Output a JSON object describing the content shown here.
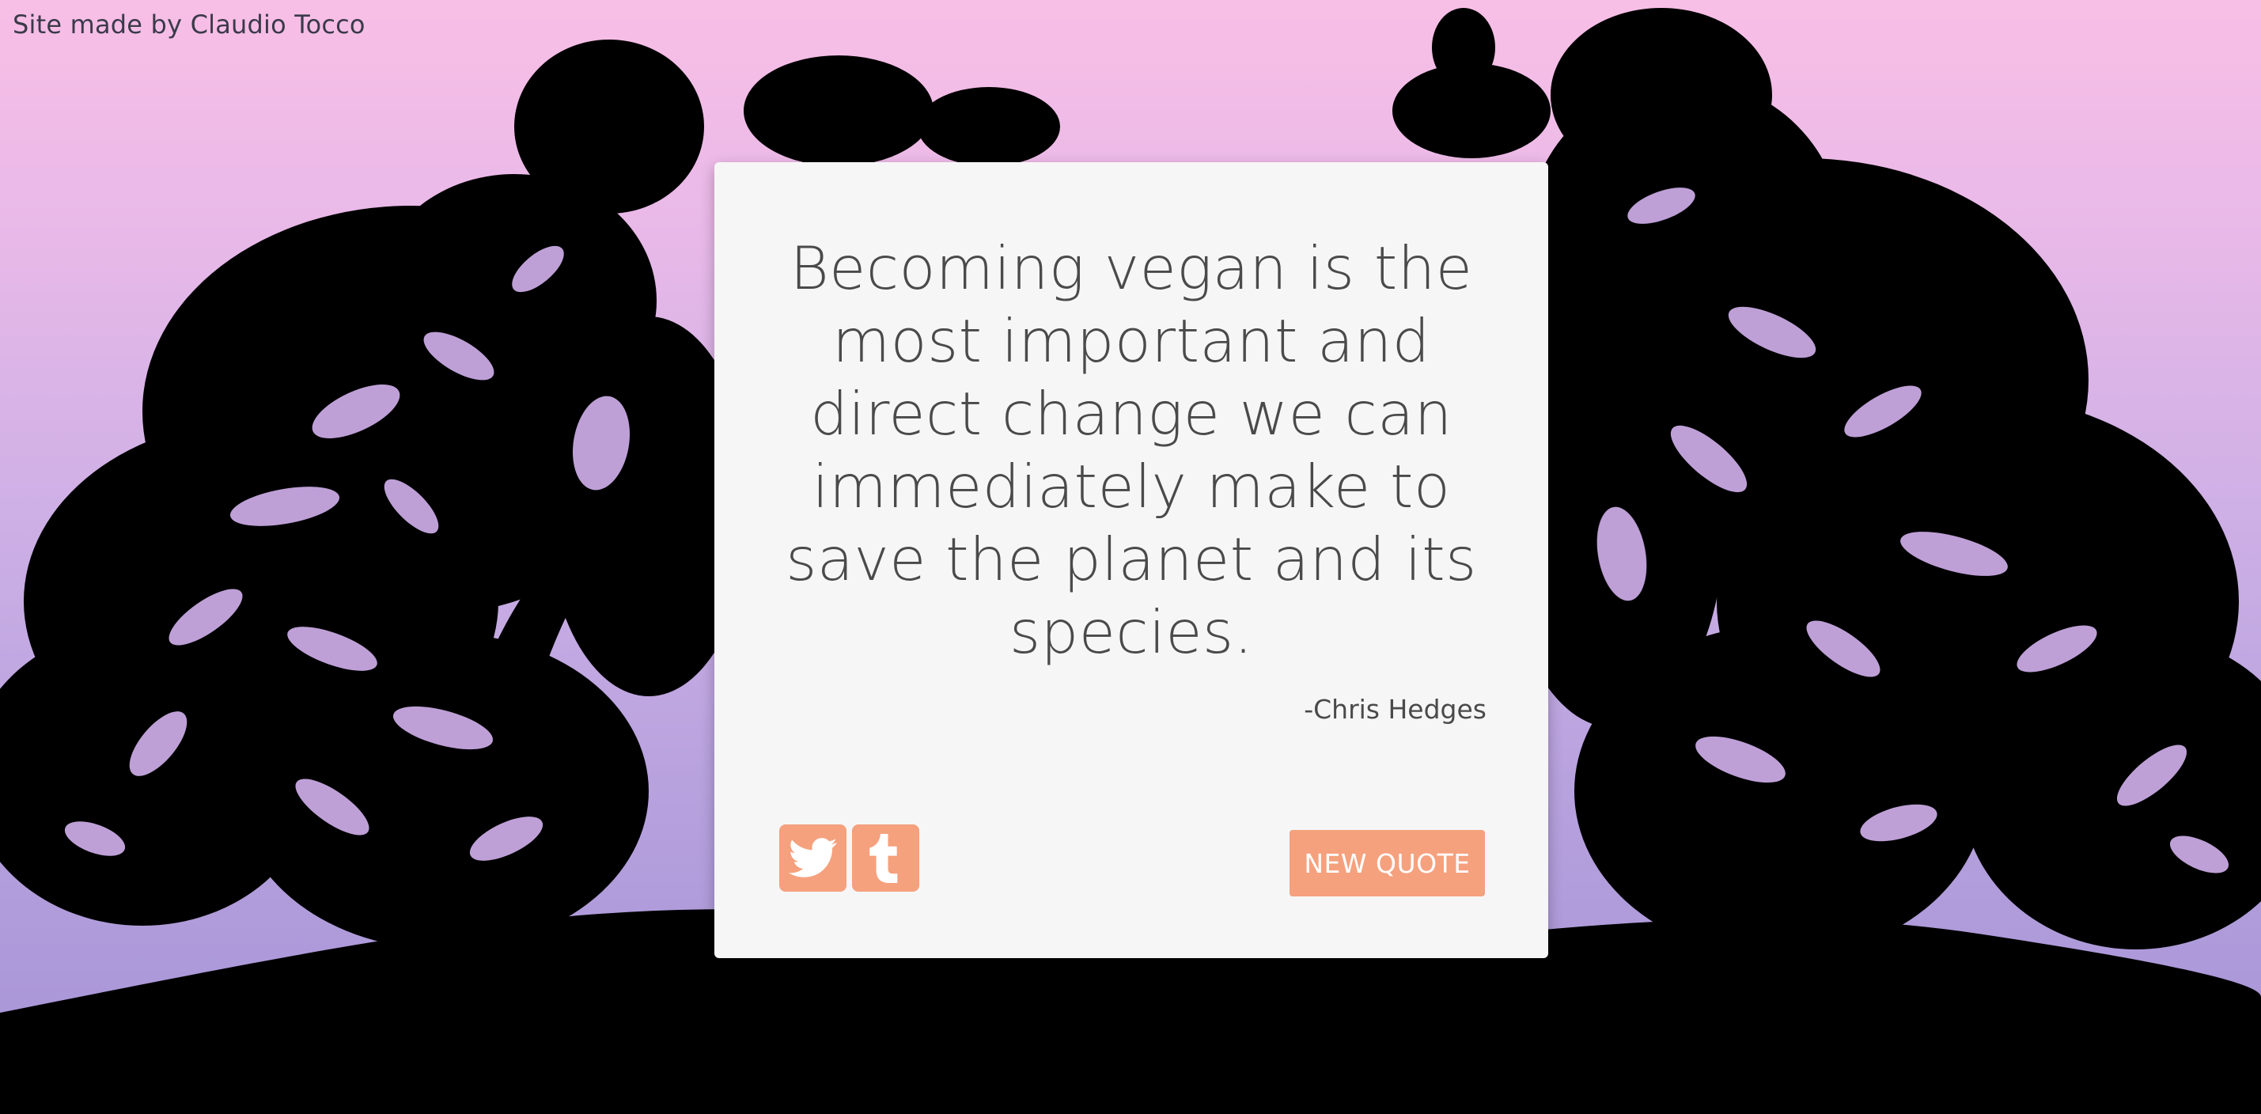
{
  "credit": "Site made by Claudio Tocco",
  "quote": {
    "text": "Becoming vegan is the most important and direct change we can immediately make to save the planet and its species.",
    "author": "-Chris Hedges"
  },
  "actions": {
    "new_quote_label": "NEW QUOTE",
    "twitter_icon": "twitter-icon",
    "tumblr_icon": "tumblr-icon"
  },
  "colors": {
    "accent": "#f5a17e",
    "card": "#f6f6f6",
    "text": "#4a4a4a",
    "gradient_top": "#f8bfe6",
    "gradient_bottom": "#a493d6",
    "tree": "#000000"
  }
}
